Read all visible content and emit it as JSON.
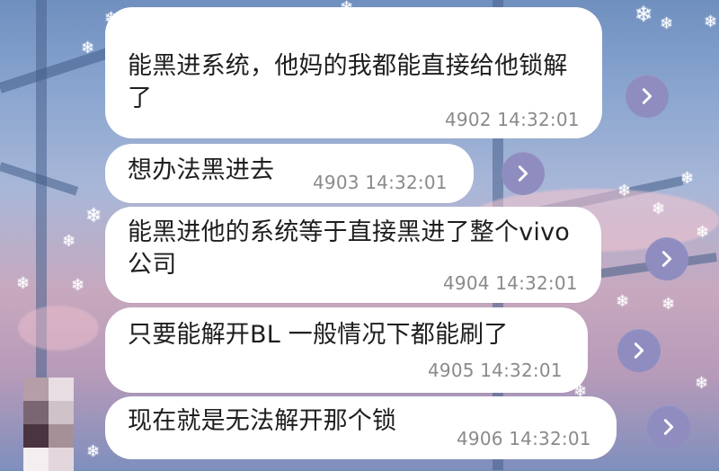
{
  "background": {
    "accent_purple": "#8f8cc0",
    "snow_icon": "snowflake-icon"
  },
  "messages": [
    {
      "text": "能黑进系统，他妈的我都能直接给他锁解了",
      "meta": "4902 14:32:01",
      "action_icon": "chevron-right-icon"
    },
    {
      "text": "想办法黑进去",
      "meta": "4903 14:32:01",
      "action_icon": "chevron-right-icon"
    },
    {
      "text": "能黑进他的系统等于直接黑进了整个vivo公司",
      "meta": "4904 14:32:01",
      "action_icon": "chevron-right-icon"
    },
    {
      "text": "只要能解开BL 一般情况下都能刷了",
      "meta": "4905 14:32:01",
      "action_icon": "chevron-right-icon"
    },
    {
      "text": "现在就是无法解开那个锁",
      "meta": "4906 14:32:01",
      "action_icon": "chevron-right-icon"
    }
  ]
}
